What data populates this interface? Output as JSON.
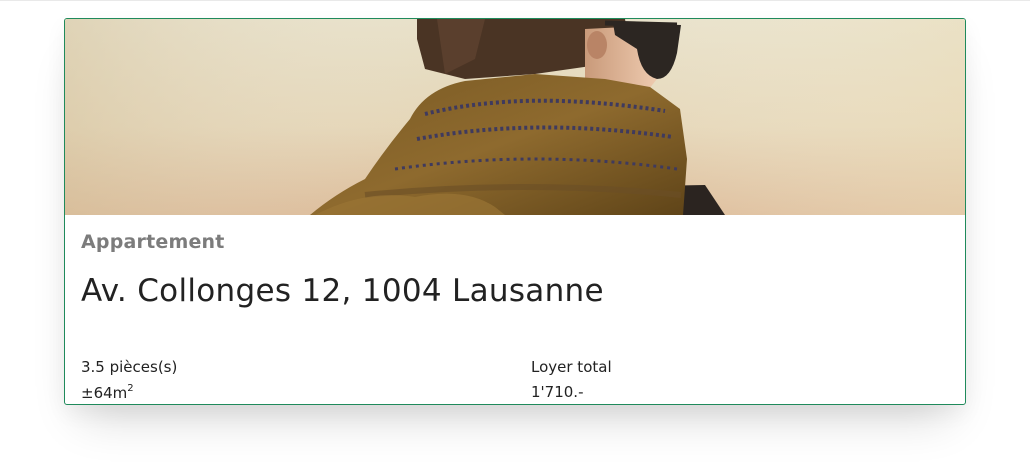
{
  "listing": {
    "image_alt": "Person with sunglasses wearing a brown scarf against a warm sunset sky",
    "category": "Appartement",
    "address": "Av. Collonges 12, 1004 Lausanne",
    "rooms": "3.5 pièces(s)",
    "area_prefix": "±64m",
    "area_superscript": "2",
    "rent_label": "Loyer total",
    "rent_value": "1'710.-"
  },
  "colors": {
    "card_border": "#1f8a5b",
    "category_text": "#7c7c7c",
    "body_text": "#222222"
  }
}
